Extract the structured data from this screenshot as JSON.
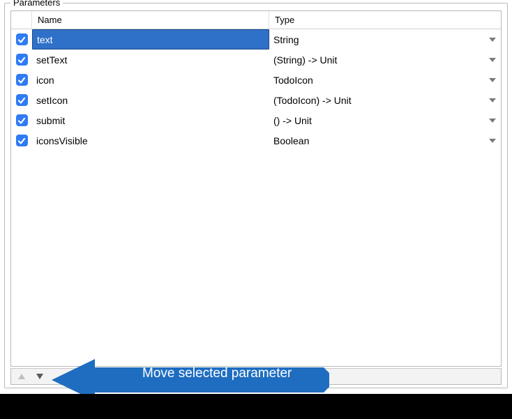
{
  "panel": {
    "title": "Parameters",
    "columns": {
      "name": "Name",
      "type": "Type"
    },
    "rows": [
      {
        "checked": true,
        "selected": true,
        "name": "text",
        "type": "String"
      },
      {
        "checked": true,
        "selected": false,
        "name": "setText",
        "type": "(String) -> Unit"
      },
      {
        "checked": true,
        "selected": false,
        "name": "icon",
        "type": "TodoIcon"
      },
      {
        "checked": true,
        "selected": false,
        "name": "setIcon",
        "type": "(TodoIcon) -> Unit"
      },
      {
        "checked": true,
        "selected": false,
        "name": "submit",
        "type": "() -> Unit"
      },
      {
        "checked": true,
        "selected": false,
        "name": "iconsVisible",
        "type": "Boolean"
      }
    ]
  },
  "callout": {
    "text": "Move selected parameter"
  },
  "colors": {
    "accent": "#2f7bf5",
    "selection": "#2f70c8",
    "callout": "#1e6dc0"
  }
}
